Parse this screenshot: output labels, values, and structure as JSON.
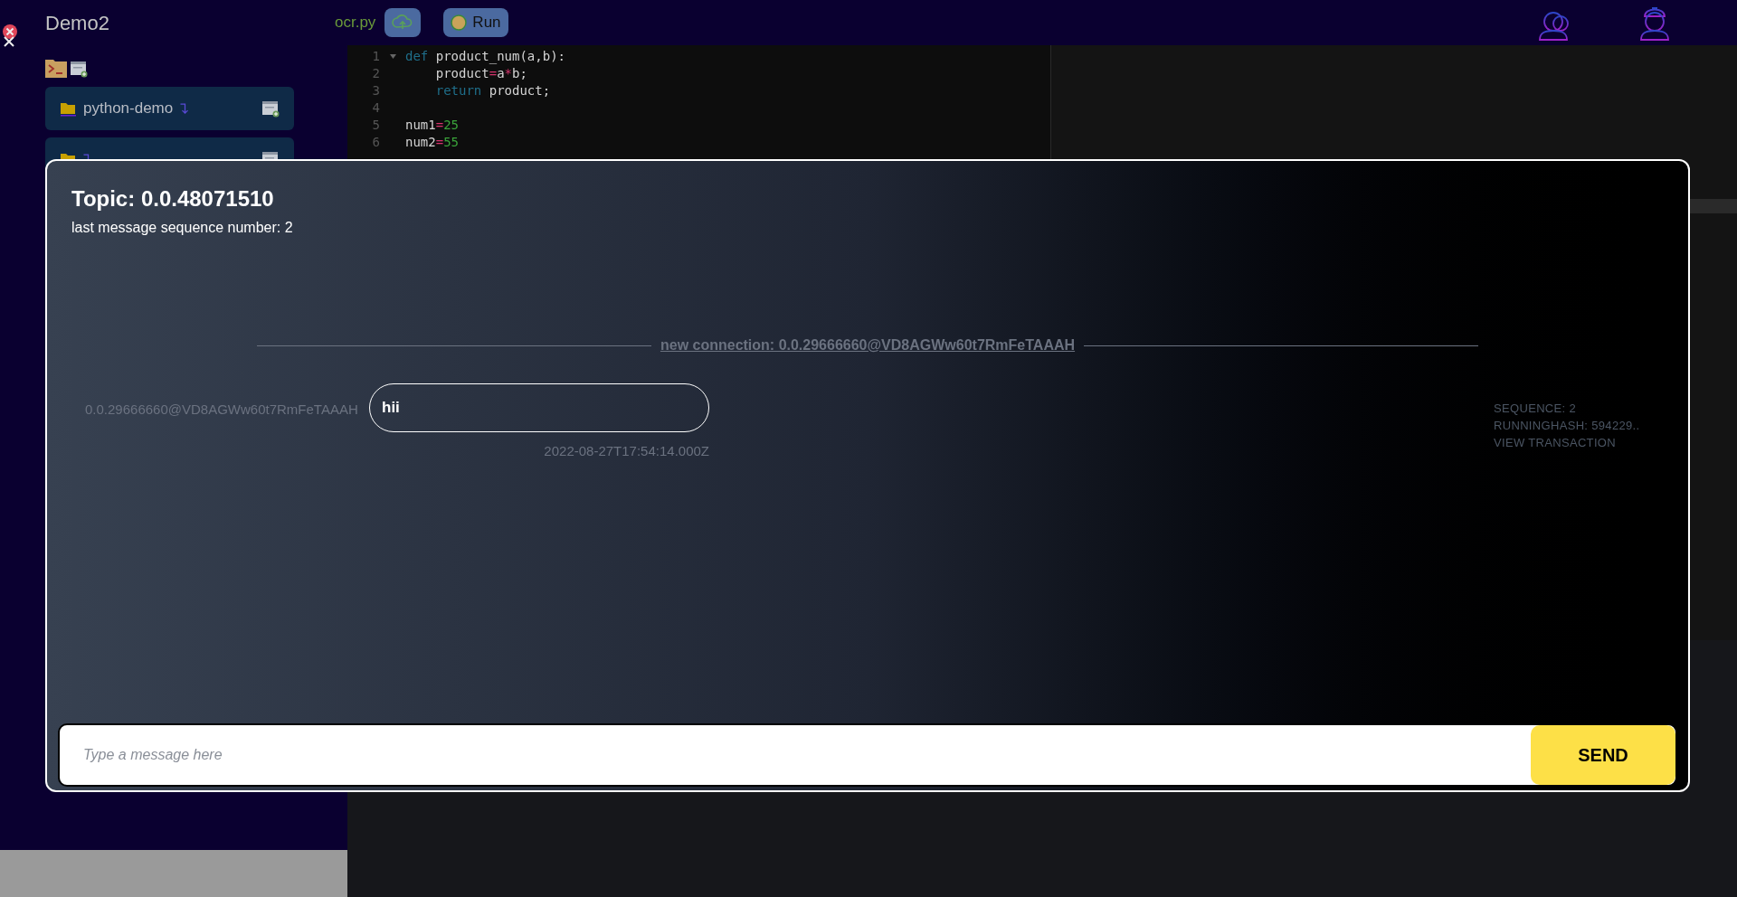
{
  "header": {
    "project": "Demo2",
    "file_name": "ocr.py",
    "run_label": "Run"
  },
  "sidebar": {
    "items": [
      {
        "kind": "folder",
        "label": "python-demo"
      },
      {
        "kind": "folder"
      }
    ]
  },
  "editor": {
    "lines": [
      {
        "number": "1",
        "fold": true,
        "tokens": [
          {
            "text": "def",
            "kind": "keyword"
          },
          {
            "text": " product_num(a,b):",
            "kind": "plain"
          }
        ]
      },
      {
        "number": "2",
        "fold": false,
        "tokens": [
          {
            "text": "    product",
            "kind": "plain"
          },
          {
            "text": "=",
            "kind": "operator"
          },
          {
            "text": "a",
            "kind": "plain"
          },
          {
            "text": "*",
            "kind": "operator"
          },
          {
            "text": "b;",
            "kind": "plain"
          }
        ]
      },
      {
        "number": "3",
        "fold": false,
        "tokens": [
          {
            "text": "    return",
            "kind": "keyword"
          },
          {
            "text": " product;",
            "kind": "plain"
          }
        ]
      },
      {
        "number": "4",
        "fold": false
      },
      {
        "number": "5",
        "fold": false,
        "tokens": [
          {
            "text": "num1",
            "kind": "plain"
          },
          {
            "text": "=",
            "kind": "operator"
          },
          {
            "text": "25",
            "kind": "number"
          }
        ]
      },
      {
        "number": "6",
        "fold": false,
        "tokens": [
          {
            "text": "num2",
            "kind": "plain"
          },
          {
            "text": "=",
            "kind": "operator"
          },
          {
            "text": "55",
            "kind": "number"
          }
        ]
      }
    ]
  },
  "chat": {
    "topic": "Topic: 0.0.48071510",
    "subtitle": "last message sequence number: 2",
    "connection": "new connection: 0.0.29666660@VD8AGWw60t7RmFeTAAAH",
    "messages": [
      {
        "sender": "0.0.29666660@VD8AGWw60t7RmFeTAAAH",
        "text": "hii",
        "timestamp": "2022-08-27T17:54:14.000Z",
        "sequence": "SEQUENCE: 2",
        "running_hash": "RUNNINGHASH: 594229..",
        "link": "VIEW TRANSACTION"
      }
    ],
    "input": {
      "placeholder": "Type a message here"
    },
    "send_label": "SEND"
  }
}
